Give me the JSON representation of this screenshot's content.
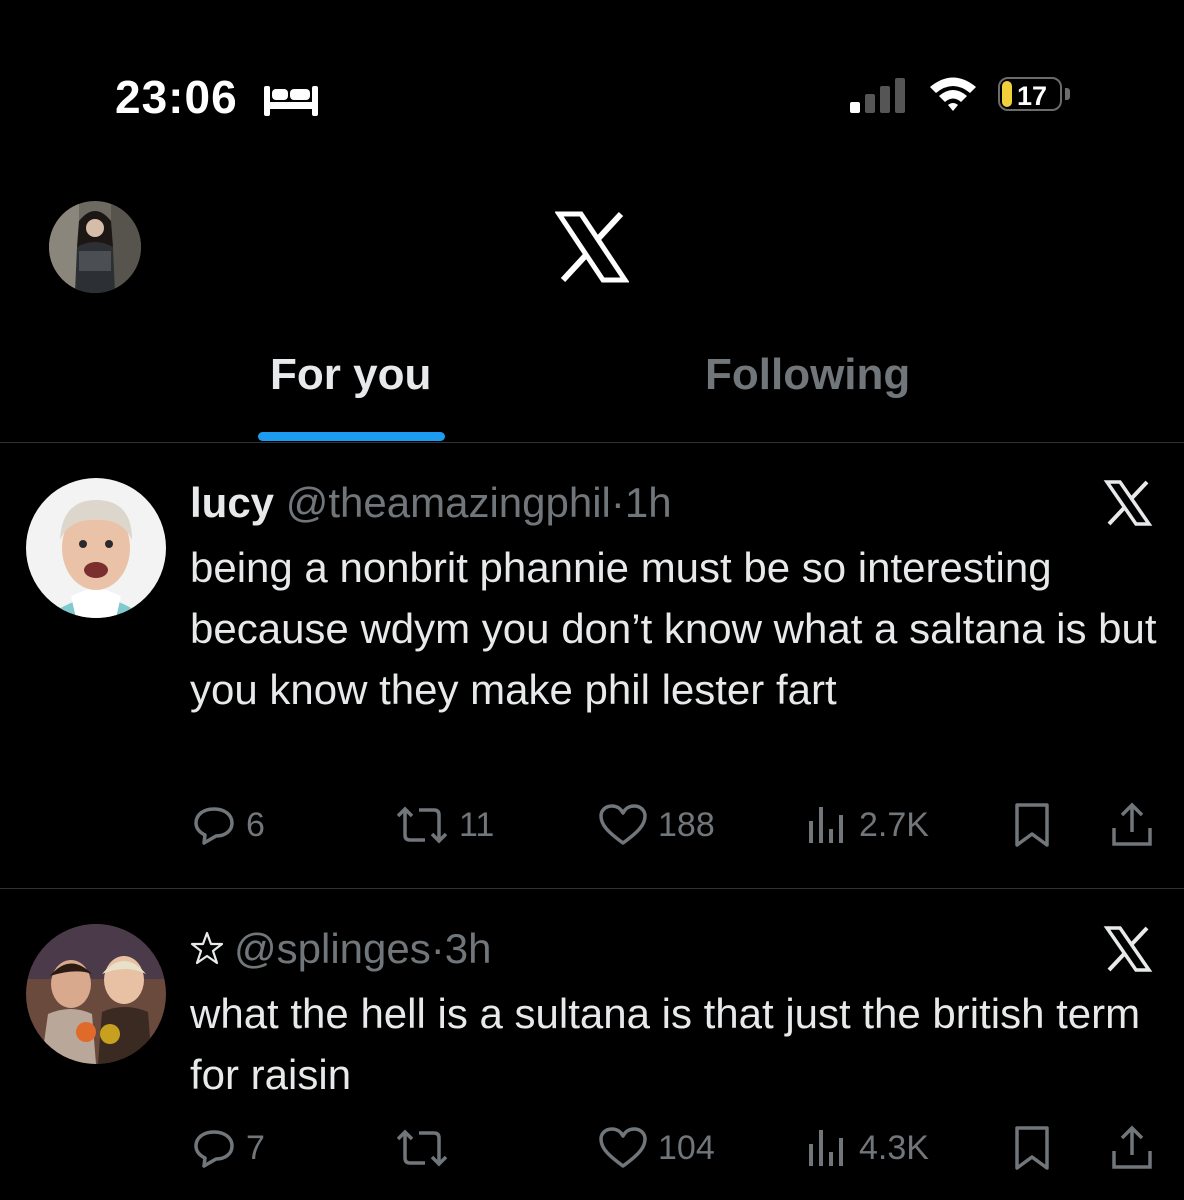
{
  "status_bar": {
    "time": "23:06",
    "battery_level": "17",
    "focus_icon": "bed-icon",
    "signal_icon": "cellular-signal-icon",
    "wifi_icon": "wifi-icon"
  },
  "header": {
    "logo_icon": "x-logo-icon",
    "profile_icon": "profile-avatar"
  },
  "tabs": [
    {
      "label": "For you",
      "active": true
    },
    {
      "label": "Following",
      "active": false
    }
  ],
  "colors": {
    "background": "#000000",
    "accent": "#1d9bf0",
    "text": "#e7e9ea",
    "muted": "#71767b",
    "divider": "#2f3336",
    "battery": "#f2d03b"
  },
  "tweets": [
    {
      "name": "lucy",
      "handle": "@theamazingphil",
      "dot": "·",
      "time": "1h",
      "text": "being a nonbrit phannie must be so interesting because wdym you don’t know what a saltana is but you know they make phil lester fart",
      "replies": "6",
      "reposts": "11",
      "likes": "188",
      "views": "2.7K"
    },
    {
      "name_icon": "star-icon",
      "handle": "@splinges",
      "dot": "·",
      "time": "3h",
      "text": "what the hell is a sultana is that just the british term for raisin",
      "replies": "7",
      "likes": "104",
      "views": "4.3K"
    }
  ]
}
